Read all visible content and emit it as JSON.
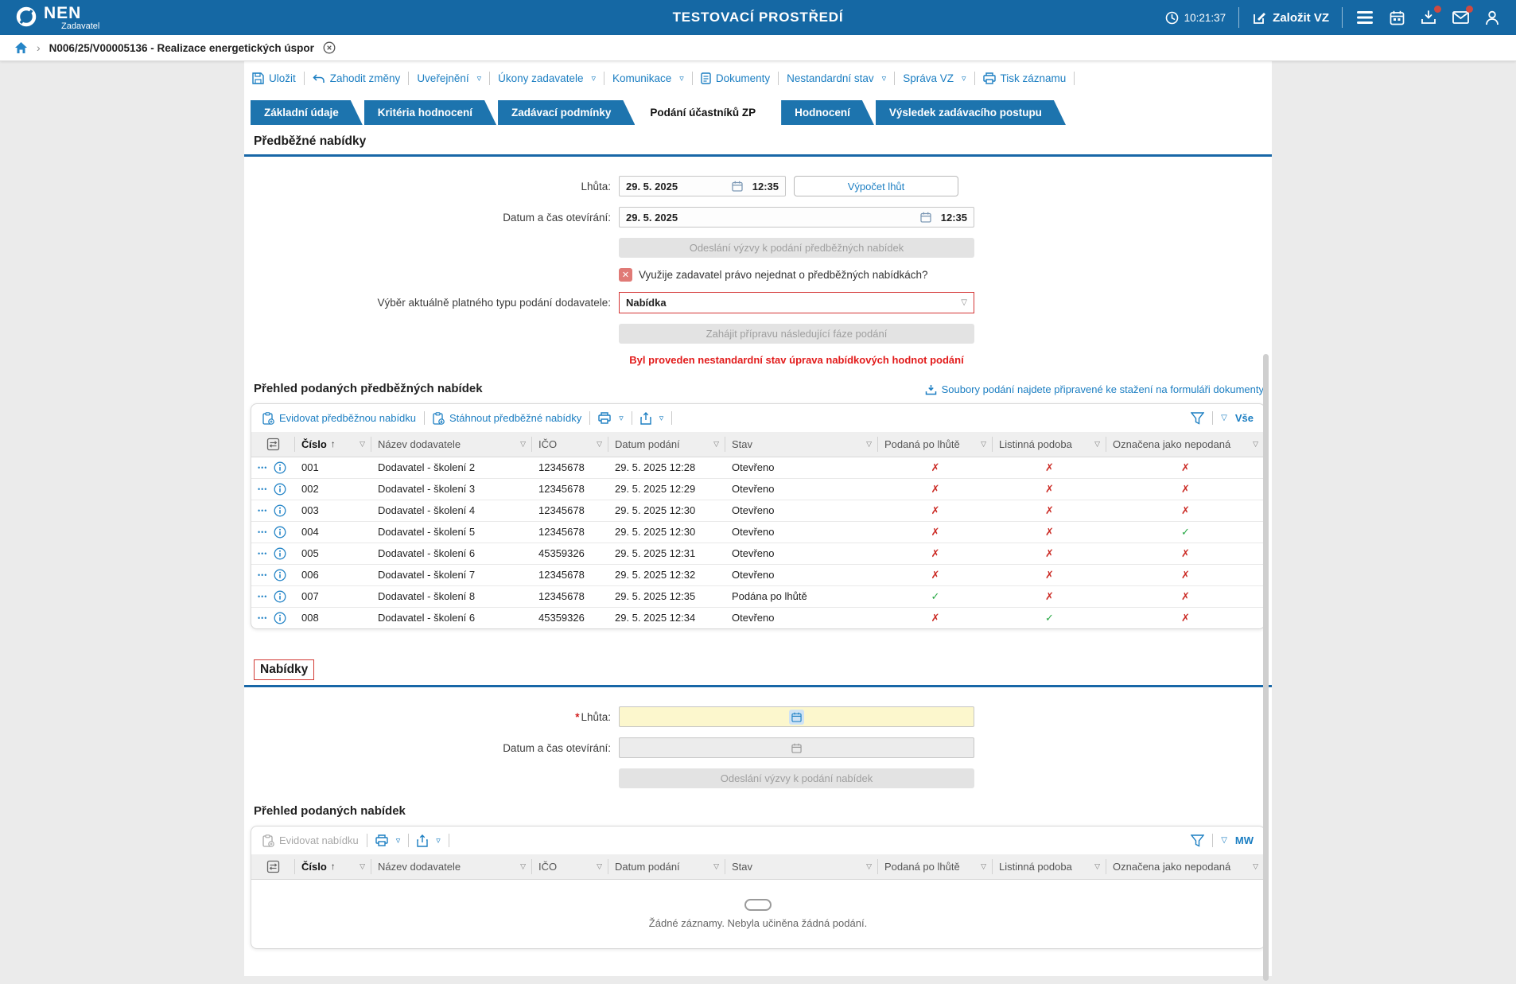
{
  "topbar": {
    "logo": "NEN",
    "logo_sub": "Zadavatel",
    "title": "TESTOVACÍ PROSTŘEDÍ",
    "time": "10:21:37",
    "new_vz": "Založit VZ"
  },
  "breadcrumb": {
    "label": "N006/25/V00005136 - Realizace energetických úspor"
  },
  "toolbar": {
    "save": "Uložit",
    "discard": "Zahodit změny",
    "publish": "Uveřejnění",
    "contracting_tasks": "Úkony zadavatele",
    "communication": "Komunikace",
    "documents": "Dokumenty",
    "nonstandard_state": "Nestandardní stav",
    "vz_admin": "Správa VZ",
    "print": "Tisk záznamu"
  },
  "tabs": [
    {
      "label": "Základní údaje"
    },
    {
      "label": "Kritéria hodnocení"
    },
    {
      "label": "Zadávací podmínky"
    },
    {
      "label": "Podání účastníků ZP"
    },
    {
      "label": "Hodnocení"
    },
    {
      "label": "Výsledek zadávacího postupu"
    }
  ],
  "prelim": {
    "title": "Předběžné nabídky",
    "deadline_label": "Lhůta:",
    "deadline_date": "29. 5. 2025",
    "deadline_time": "12:35",
    "calc_button": "Výpočet lhůt",
    "opening_label": "Datum a čas otevírání:",
    "opening_date": "29. 5. 2025",
    "opening_time": "12:35",
    "send_call_button": "Odeslání výzvy k podání předběžných nabídek",
    "negotiate_question": "Využije zadavatel právo nejednat o předběžných nabídkách?",
    "negotiate_mark": "✕",
    "type_label": "Výběr aktuálně platného typu podání dodavatele:",
    "type_value": "Nabídka",
    "next_phase_button": "Zahájit přípravu následující fáze podání",
    "warning": "Byl proveden nestandardní stav úprava nabídkových hodnot podání"
  },
  "prelim_table": {
    "heading": "Přehled podaných předběžných nabídek",
    "files_link": "Soubory podání najdete připravené ke stažení na formuláři dokumenty",
    "register": "Evidovat předběžnou nabídku",
    "download": "Stáhnout předběžné nabídky",
    "scope": "Vše",
    "rows": [
      {
        "cislo": "001",
        "nazev": "Dodavatel - školení 2",
        "ico": "12345678",
        "datum": "29. 5. 2025 12:28",
        "stav": "Otevřeno",
        "po_lhute": "✗",
        "listinna": "✗",
        "nepodana": "✗"
      },
      {
        "cislo": "002",
        "nazev": "Dodavatel - školení 3",
        "ico": "12345678",
        "datum": "29. 5. 2025 12:29",
        "stav": "Otevřeno",
        "po_lhute": "✗",
        "listinna": "✗",
        "nepodana": "✗"
      },
      {
        "cislo": "003",
        "nazev": "Dodavatel - školení 4",
        "ico": "12345678",
        "datum": "29. 5. 2025 12:30",
        "stav": "Otevřeno",
        "po_lhute": "✗",
        "listinna": "✗",
        "nepodana": "✗"
      },
      {
        "cislo": "004",
        "nazev": "Dodavatel - školení 5",
        "ico": "12345678",
        "datum": "29. 5. 2025 12:30",
        "stav": "Otevřeno",
        "po_lhute": "✗",
        "listinna": "✗",
        "nepodana": "✓"
      },
      {
        "cislo": "005",
        "nazev": "Dodavatel - školení 6",
        "ico": "45359326",
        "datum": "29. 5. 2025 12:31",
        "stav": "Otevřeno",
        "po_lhute": "✗",
        "listinna": "✗",
        "nepodana": "✗"
      },
      {
        "cislo": "006",
        "nazev": "Dodavatel - školení 7",
        "ico": "12345678",
        "datum": "29. 5. 2025 12:32",
        "stav": "Otevřeno",
        "po_lhute": "✗",
        "listinna": "✗",
        "nepodana": "✗"
      },
      {
        "cislo": "007",
        "nazev": "Dodavatel - školení 8",
        "ico": "12345678",
        "datum": "29. 5. 2025 12:35",
        "stav": "Podána po lhůtě",
        "po_lhute": "✓",
        "listinna": "✗",
        "nepodana": "✗"
      },
      {
        "cislo": "008",
        "nazev": "Dodavatel - školení 6",
        "ico": "45359326",
        "datum": "29. 5. 2025 12:34",
        "stav": "Otevřeno",
        "po_lhute": "✗",
        "listinna": "✓",
        "nepodana": "✗"
      }
    ]
  },
  "columns": {
    "cislo": "Číslo",
    "nazev": "Název dodavatele",
    "ico": "IČO",
    "datum": "Datum podání",
    "stav": "Stav",
    "po_lhute": "Podaná po lhůtě",
    "listinna": "Listinná podoba",
    "nepodana": "Označena jako nepodaná"
  },
  "offers": {
    "title": "Nabídky",
    "deadline_label": "Lhůta:",
    "opening_label": "Datum a čas otevírání:",
    "send_call_button": "Odeslání výzvy k podání nabídek"
  },
  "offers_table": {
    "heading": "Přehled podaných nabídek",
    "register": "Evidovat nabídku",
    "scope": "MW",
    "empty_text": "Žádné záznamy. Nebyla učiněna žádná podání."
  }
}
